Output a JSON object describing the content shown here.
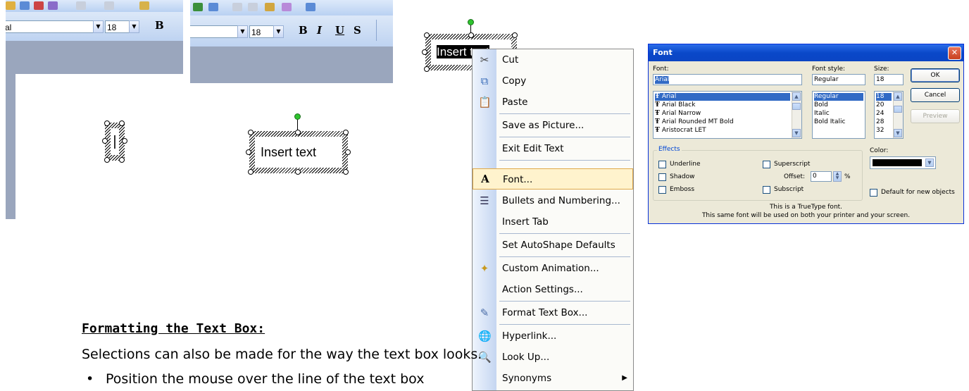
{
  "shot1": {
    "font_name": "al",
    "font_size": "18",
    "bold_label": "B",
    "cursor_text": "|"
  },
  "shot2": {
    "font_size": "18",
    "format_buttons": [
      "B",
      "I",
      "U",
      "S"
    ]
  },
  "textbox_middle": {
    "text": "Insert text"
  },
  "textbox_selected": {
    "text": "Insert text"
  },
  "context_menu": {
    "items": [
      {
        "label": "Cut",
        "icon": "scissors-icon"
      },
      {
        "label": "Copy",
        "icon": "copy-icon"
      },
      {
        "label": "Paste",
        "icon": "paste-icon"
      },
      {
        "label": "Save as Picture...",
        "icon": ""
      },
      {
        "label": "Exit Edit Text",
        "icon": ""
      },
      {
        "label": "Font...",
        "icon": "font-icon"
      },
      {
        "label": "Bullets and Numbering...",
        "icon": "bullets-icon"
      },
      {
        "label": "Insert Tab",
        "icon": ""
      },
      {
        "label": "Set AutoShape Defaults",
        "icon": ""
      },
      {
        "label": "Custom Animation...",
        "icon": "animation-icon"
      },
      {
        "label": "Action Settings...",
        "icon": ""
      },
      {
        "label": "Format Text Box...",
        "icon": "format-textbox-icon"
      },
      {
        "label": "Hyperlink...",
        "icon": "hyperlink-icon"
      },
      {
        "label": "Look Up...",
        "icon": "lookup-icon"
      },
      {
        "label": "Synonyms",
        "icon": ""
      }
    ],
    "highlighted": "Font..."
  },
  "font_dialog": {
    "title": "Font",
    "font_label": "Font:",
    "font_value": "Arial",
    "font_list": [
      "Arial",
      "Arial Black",
      "Arial Narrow",
      "Arial Rounded MT Bold",
      "Aristocrat LET"
    ],
    "style_label": "Font style:",
    "style_value": "Regular",
    "style_list": [
      "Regular",
      "Bold",
      "Italic",
      "Bold Italic"
    ],
    "size_label": "Size:",
    "size_value": "18",
    "size_list": [
      "18",
      "20",
      "24",
      "28",
      "32"
    ],
    "ok_label": "OK",
    "cancel_label": "Cancel",
    "preview_label": "Preview",
    "effects_label": "Effects",
    "underline_label": "Underline",
    "shadow_label": "Shadow",
    "emboss_label": "Emboss",
    "superscript_label": "Superscript",
    "offset_label": "Offset:",
    "offset_value": "0",
    "percent_label": "%",
    "subscript_label": "Subscript",
    "color_label": "Color:",
    "color_value": "#000000",
    "default_label": "Default for new objects",
    "info_line1": "This is a TrueType font.",
    "info_line2": "This same font will be used on both your printer and your screen."
  },
  "document": {
    "heading": "Formatting the Text Box:",
    "body": "Selections can also be made for the way the text box looks.",
    "bullet": "Position the mouse over the line of the text box"
  }
}
